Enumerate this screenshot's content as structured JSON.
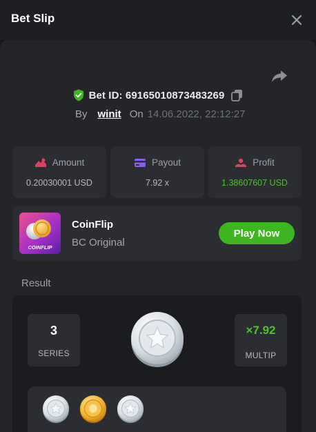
{
  "header": {
    "title": "Bet Slip",
    "close_icon": "close-icon"
  },
  "bet": {
    "id_label": "Bet ID:",
    "id": "69165010873483269",
    "by_label": "By",
    "user": "winit",
    "on_label": "On",
    "date": "14.06.2022, 22:12:27"
  },
  "stats": [
    {
      "label": "Amount",
      "value": "0.20030001 USD",
      "icon": "amount-icon",
      "color": "#e0405e"
    },
    {
      "label": "Payout",
      "value": "7.92 x",
      "icon": "payout-icon",
      "color": "#8b5cf6"
    },
    {
      "label": "Profit",
      "value": "1.38607607 USD",
      "icon": "profit-icon",
      "color": "#e0405e"
    }
  ],
  "game": {
    "name": "CoinFlip",
    "subtitle": "BC Original",
    "thumb_label": "COINFLIP",
    "play_label": "Play Now"
  },
  "result": {
    "label": "Result",
    "series_value": "3",
    "series_caption": "SERIES",
    "multiplier": "×7.92",
    "multiplier_caption": "MULTIP",
    "history": [
      "silver",
      "gold",
      "silver"
    ]
  },
  "colors": {
    "accent_green": "#3db621",
    "profit_green": "#4fc32b",
    "panel": "#232529",
    "card": "#2b2d32"
  }
}
